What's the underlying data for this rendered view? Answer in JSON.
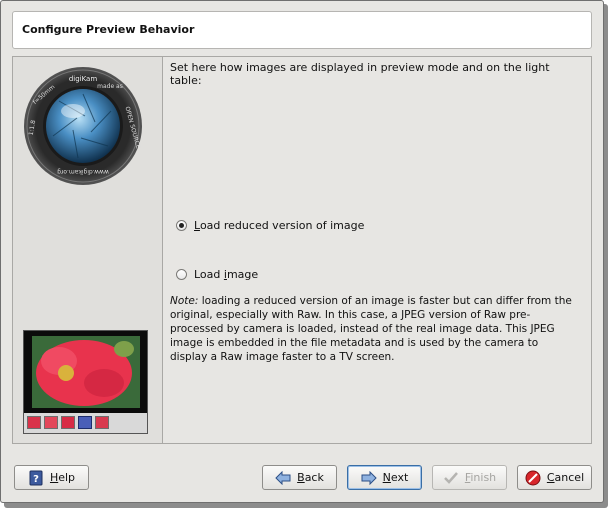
{
  "window": {
    "title": "Configure Preview Behavior"
  },
  "main": {
    "description": "Set here how images are displayed in preview mode and on the light table:",
    "options": [
      {
        "pre": "",
        "u": "L",
        "post": "oad reduced version of image",
        "checked": true
      },
      {
        "pre": "Load ",
        "u": "i",
        "post": "mage",
        "checked": false
      }
    ],
    "note_label": "Note:",
    "note_text": " loading a reduced version of an image is faster but can differ from the original, especially with Raw. In this case, a JPEG version of Raw pre-processed by camera is loaded, instead of the real image data. This JPEG image is embedded in the file metadata and is used by the camera to display a Raw image faster to a TV screen."
  },
  "sidebar": {
    "logo": {
      "brand": "digiKam",
      "made_as": "made as",
      "open_source": "OPEN SOURCE",
      "focal": "f=50mm",
      "aperture": "1:1.8",
      "url": "www.digikam.org"
    }
  },
  "buttons": {
    "help": {
      "u": "H",
      "rest": "elp"
    },
    "back": {
      "u": "B",
      "rest": "ack"
    },
    "next": {
      "u": "N",
      "rest": "ext"
    },
    "finish": {
      "u": "F",
      "rest": "inish"
    },
    "cancel": {
      "u": "C",
      "rest": "ancel"
    }
  },
  "colors": {
    "accent": "#3a6ea5",
    "photo_flower": "#e8334d"
  }
}
